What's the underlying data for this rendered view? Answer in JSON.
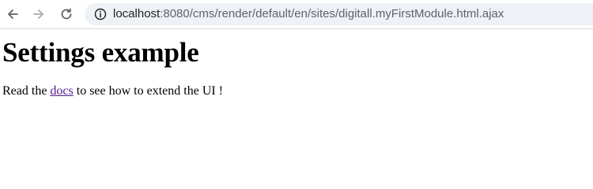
{
  "browser": {
    "back_icon": "arrow-left-icon",
    "forward_icon": "arrow-right-icon",
    "reload_icon": "reload-icon",
    "info_icon": "info-icon",
    "url_host": "localhost",
    "url_rest": ":8080/cms/render/default/en/sites/digitall.myFirstModule.html.ajax"
  },
  "page": {
    "title": "Settings example",
    "paragraph_before": "Read the ",
    "link_text": "docs",
    "paragraph_after": " to see how to extend the UI !"
  },
  "colors": {
    "link_visited": "#551a8b",
    "address_bar_bg": "#eef1f5"
  }
}
